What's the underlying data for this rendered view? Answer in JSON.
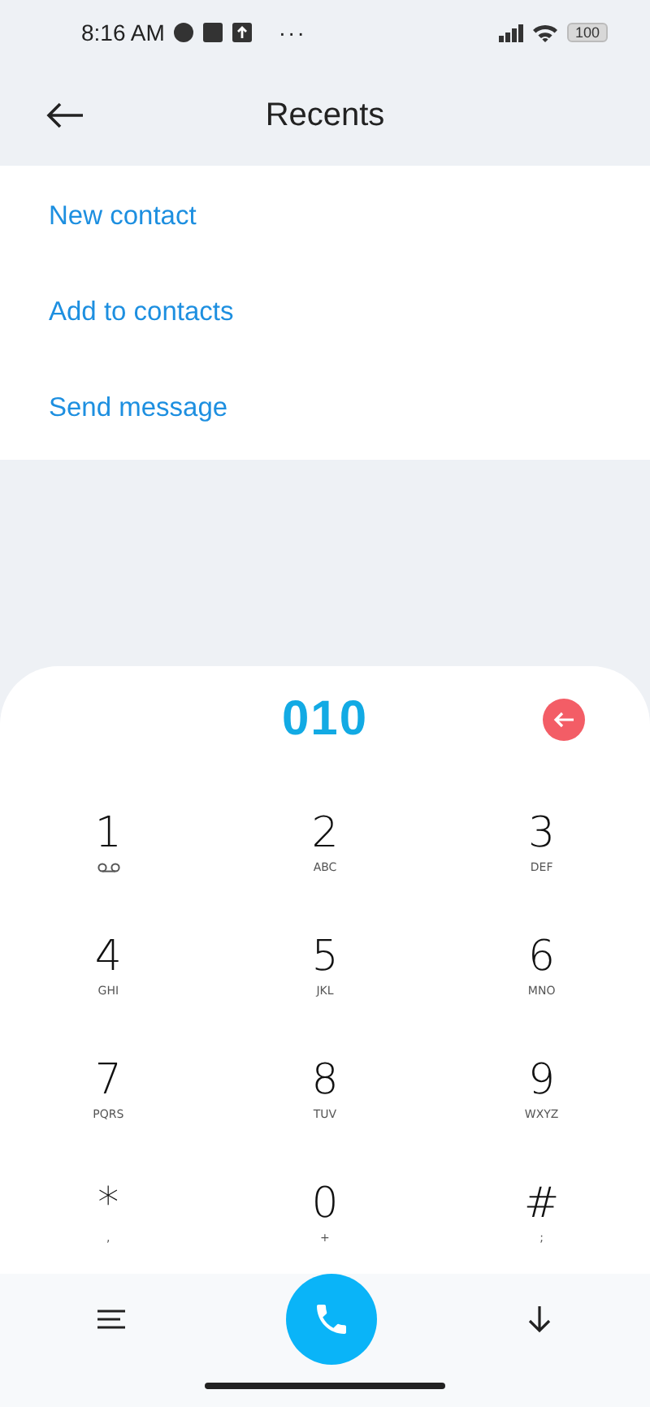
{
  "status_bar": {
    "time": "8:16 AM",
    "overflow": "···",
    "battery": "100"
  },
  "header": {
    "title": "Recents"
  },
  "menu": [
    "New contact",
    "Add to contacts",
    "Send message"
  ],
  "dialpad": {
    "number": "010",
    "keys": [
      {
        "digit": "1",
        "kind": "voicemail"
      },
      {
        "digit": "2",
        "kind": "letters",
        "sub": "ABC"
      },
      {
        "digit": "3",
        "kind": "letters",
        "sub": "DEF"
      },
      {
        "digit": "4",
        "kind": "letters",
        "sub": "GHI"
      },
      {
        "digit": "5",
        "kind": "letters",
        "sub": "JKL"
      },
      {
        "digit": "6",
        "kind": "letters",
        "sub": "MNO"
      },
      {
        "digit": "7",
        "kind": "letters",
        "sub": "PQRS"
      },
      {
        "digit": "8",
        "kind": "letters",
        "sub": "TUV"
      },
      {
        "digit": "9",
        "kind": "letters",
        "sub": "WXYZ"
      },
      {
        "digit": "*",
        "kind": "letters",
        "sub": ","
      },
      {
        "digit": "0",
        "kind": "letters",
        "sub": "+"
      },
      {
        "digit": "#",
        "kind": "letters",
        "sub": ";"
      }
    ]
  }
}
